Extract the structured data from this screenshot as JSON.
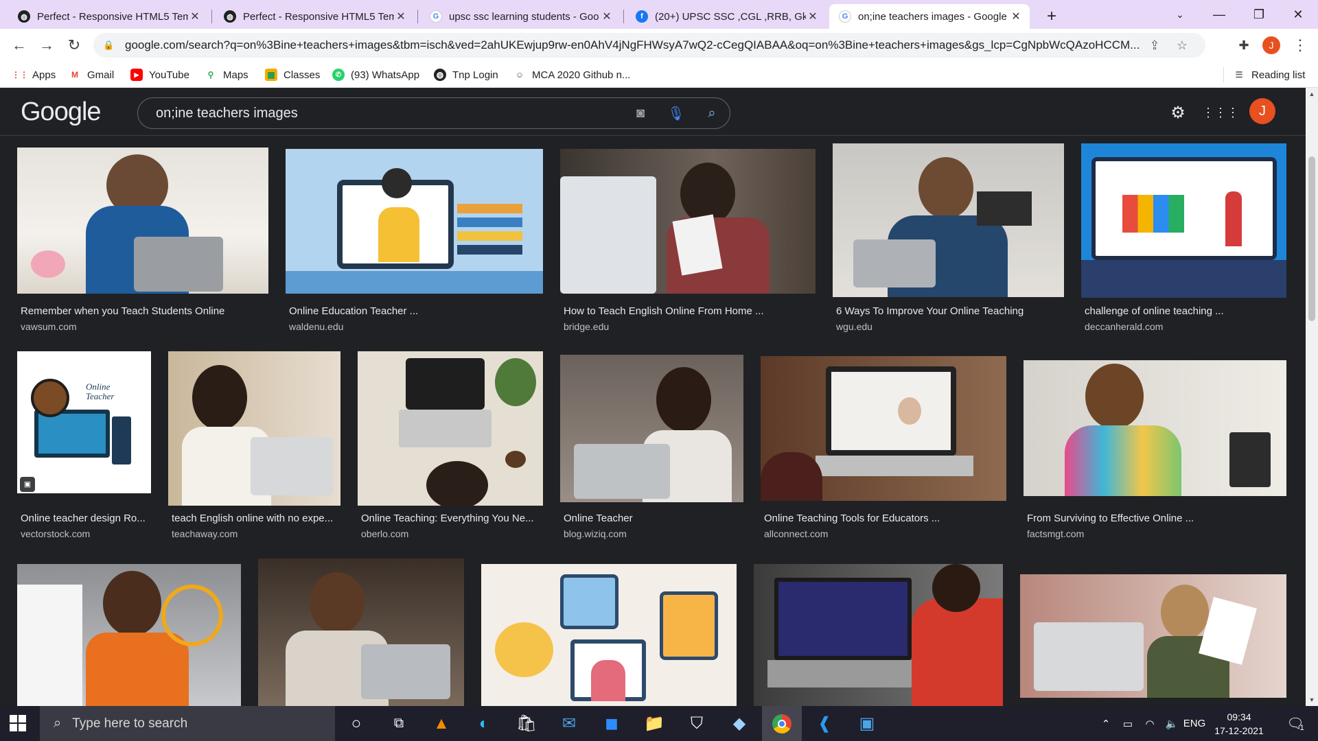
{
  "browser": {
    "tabs": [
      {
        "title": "Perfect - Responsive HTML5 Tem",
        "icon": "globe-icon",
        "active": false
      },
      {
        "title": "Perfect - Responsive HTML5 Tem",
        "icon": "globe-icon",
        "active": false
      },
      {
        "title": "upsc ssc learning students - Goo",
        "icon": "google-icon",
        "active": false
      },
      {
        "title": "(20+) UPSC SSC ,CGL ,RRB, Gk &",
        "icon": "facebook-icon",
        "active": false
      },
      {
        "title": "on;ine teachers images - Google",
        "icon": "google-icon",
        "active": true
      }
    ],
    "url": "google.com/search?q=on%3Bine+teachers+images&tbm=isch&ved=2ahUKEwjup9rw-en0AhV4jNgFHWsyA7wQ2-cCegQIABAA&oq=on%3Bine+teachers+images&gs_lcp=CgNpbWcQAzoHCCM...",
    "profile_initial": "J",
    "bookmarks": [
      {
        "label": "Apps",
        "icon": "apps-grid-icon"
      },
      {
        "label": "Gmail",
        "icon": "gmail-icon"
      },
      {
        "label": "YouTube",
        "icon": "youtube-icon"
      },
      {
        "label": "Maps",
        "icon": "maps-pin-icon"
      },
      {
        "label": "Classes",
        "icon": "classroom-icon"
      },
      {
        "label": "(93) WhatsApp",
        "icon": "whatsapp-icon"
      },
      {
        "label": "Tnp Login",
        "icon": "globe-icon"
      },
      {
        "label": "MCA 2020 Github n...",
        "icon": "github-icon"
      }
    ],
    "reading_list": "Reading list"
  },
  "google": {
    "logo": "Google",
    "query": "on;ine teachers images",
    "account_initial": "J"
  },
  "results": [
    {
      "caption": "Remember when you Teach Students Online",
      "source": "vawsum.com"
    },
    {
      "caption": "Online Education Teacher ...",
      "source": "waldenu.edu"
    },
    {
      "caption": "How to Teach English Online From Home ...",
      "source": "bridge.edu"
    },
    {
      "caption": "6 Ways To Improve Your Online Teaching",
      "source": "wgu.edu"
    },
    {
      "caption": "challenge of online teaching ...",
      "source": "deccanherald.com"
    },
    {
      "caption": "Online teacher design Ro...",
      "source": "vectorstock.com"
    },
    {
      "caption": "teach English online with no expe...",
      "source": "teachaway.com"
    },
    {
      "caption": "Online Teaching: Everything You Ne...",
      "source": "oberlo.com"
    },
    {
      "caption": "Online Teacher",
      "source": "blog.wiziq.com"
    },
    {
      "caption": "Online Teaching Tools for Educators ...",
      "source": "allconnect.com"
    },
    {
      "caption": "From Surviving to Effective Online ...",
      "source": "factsmgt.com"
    }
  ],
  "thumbnail_text": {
    "online_teacher_art": "Online Teacher"
  },
  "taskbar": {
    "search_placeholder": "Type here to search",
    "language": "ENG",
    "time": "09:34",
    "date": "17-12-2021",
    "notification_count": "1"
  },
  "colors": {
    "tab_strip": "#e8d9f8",
    "google_dark_bg": "#202124",
    "avatar": "#e8501f",
    "taskbar": "#1f1f2b"
  }
}
